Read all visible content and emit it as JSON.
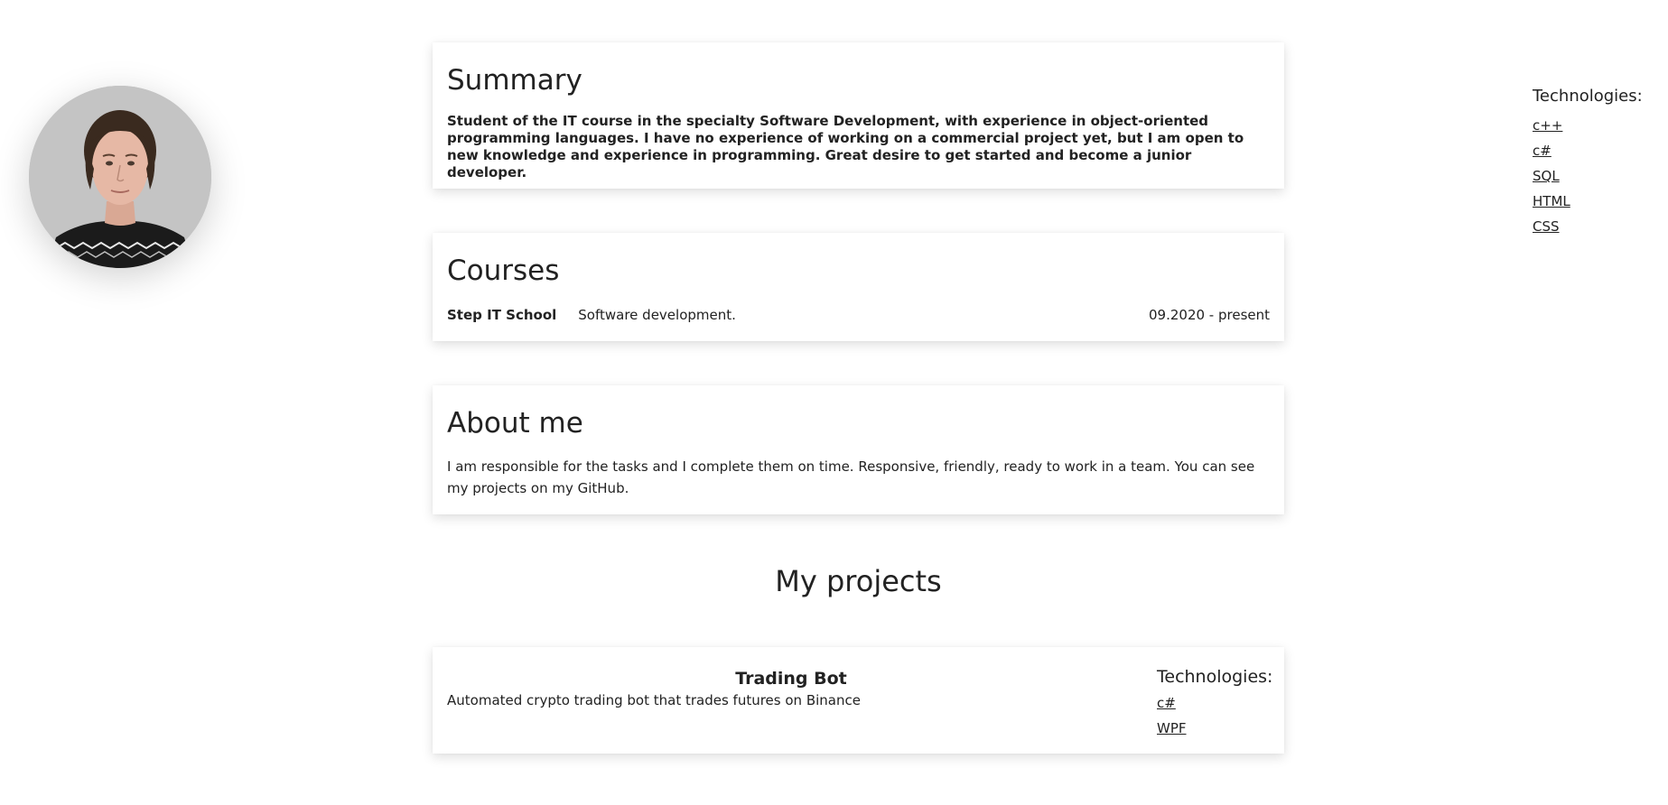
{
  "profile": {
    "avatar_icon": "portrait-photo"
  },
  "sidebar_tech": {
    "title": "Technologies:",
    "items": [
      "c++",
      "c#",
      "SQL",
      "HTML",
      "CSS"
    ]
  },
  "summary": {
    "title": "Summary",
    "text": "Student of the IT course in the specialty Software Development, with experience in object-oriented programming languages. I have no experience of working on a commercial project yet, but I am open to new knowledge and experience in programming. Great desire to get started and become a junior developer."
  },
  "courses": {
    "title": "Courses",
    "items": [
      {
        "school": "Step IT School",
        "description": "Software development.",
        "dates": "09.2020 - present"
      }
    ]
  },
  "about": {
    "title": "About me",
    "text": "I am responsible for the tasks and I complete them on time. Responsive, friendly, ready to work in a team. You can see my projects on my GitHub."
  },
  "projects": {
    "heading": "My projects",
    "items": [
      {
        "title": "Trading Bot",
        "description": "Automated crypto trading bot that trades futures on Binance",
        "tech_title": "Technologies:",
        "tech": [
          "c#",
          "WPF"
        ]
      }
    ]
  }
}
